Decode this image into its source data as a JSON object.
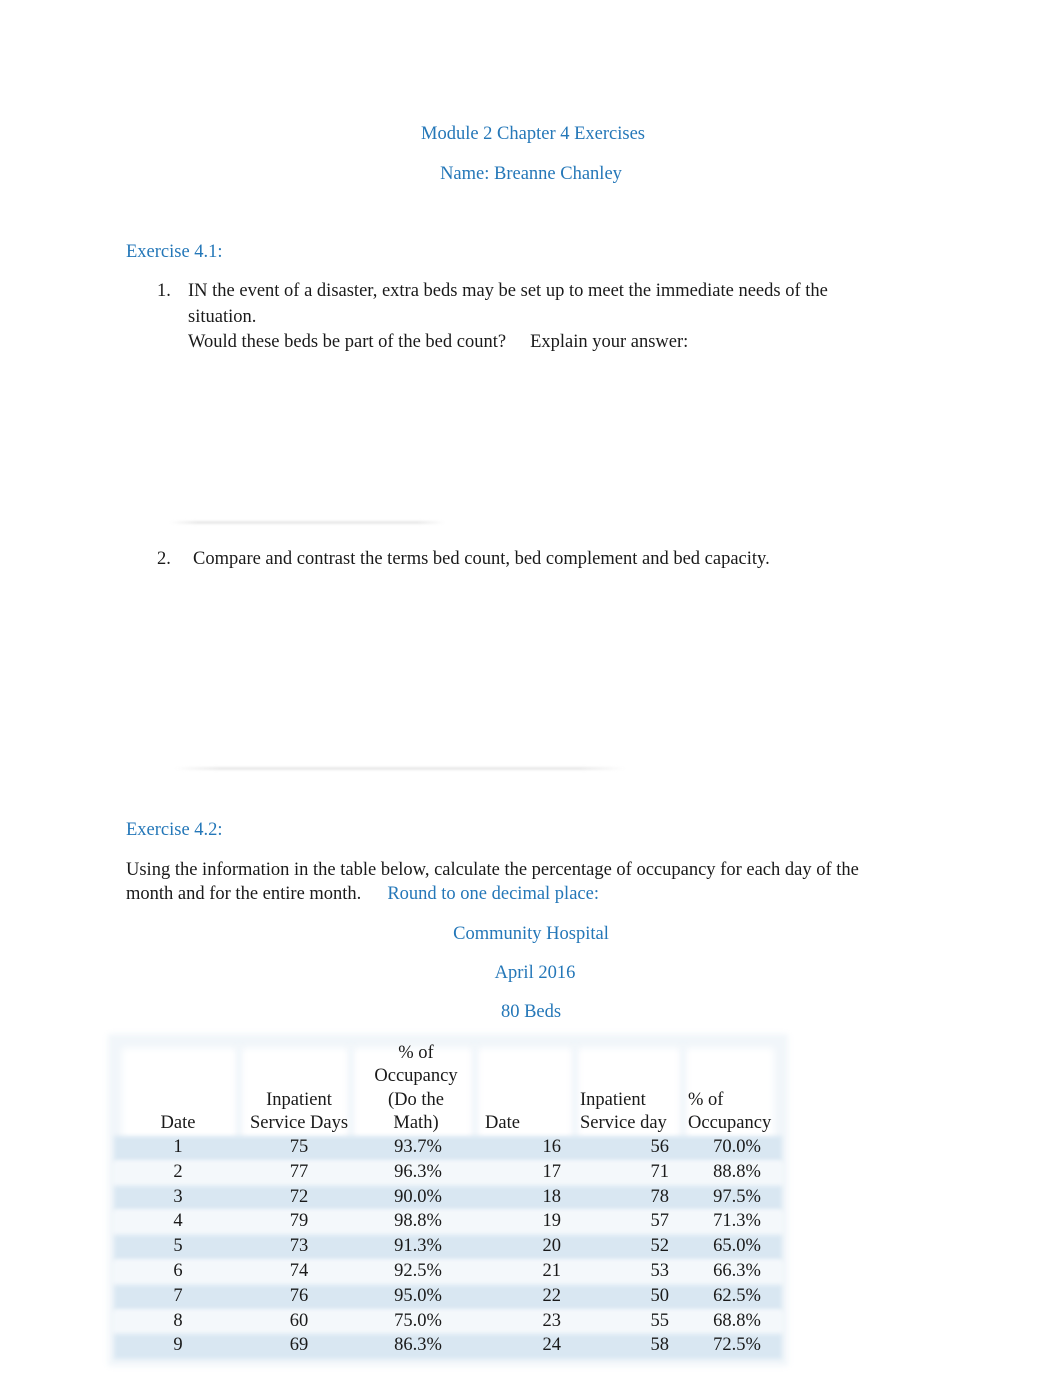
{
  "document": {
    "title": "Module 2 Chapter 4 Exercises",
    "name_line": "Name: Breanne Chanley"
  },
  "exercise_4_1": {
    "heading": "Exercise 4.1:",
    "questions": [
      {
        "number": "1.",
        "line1": "IN the event of a disaster, extra beds may be set up to meet the immediate needs of the",
        "line2": "situation.",
        "line3a": "Would these beds be part of the bed count?",
        "line3b": "Explain your answer:"
      },
      {
        "number": "2.",
        "text": "Compare and contrast the terms bed count, bed complement and bed capacity."
      }
    ]
  },
  "exercise_4_2": {
    "heading": "Exercise 4.2:",
    "instructions_line1": "Using the information in the table below, calculate the percentage of occupancy for each day of the",
    "instructions_line2": "month and for the entire month.",
    "instructions_highlight": "Round to one decimal place:",
    "table_title": "Community Hospital",
    "table_period": "April 2016",
    "table_beds": "80 Beds",
    "headers": {
      "date_left": "Date",
      "isd_left_1": "Inpatient",
      "isd_left_2": "Service Days",
      "occ_left_1": "% of",
      "occ_left_2": "Occupancy",
      "occ_left_3": "(Do the",
      "occ_left_4": "Math)",
      "date_right": "Date",
      "isd_right_1": "Inpatient",
      "isd_right_2": "Service day",
      "occ_right_1": "% of",
      "occ_right_2": "Occupancy"
    },
    "rows": [
      {
        "date_l": "1",
        "isd_l": "75",
        "occ_l": "93.7%",
        "date_r": "16",
        "isd_r": "56",
        "occ_r": "70.0%"
      },
      {
        "date_l": "2",
        "isd_l": "77",
        "occ_l": "96.3%",
        "date_r": "17",
        "isd_r": "71",
        "occ_r": "88.8%"
      },
      {
        "date_l": "3",
        "isd_l": "72",
        "occ_l": "90.0%",
        "date_r": "18",
        "isd_r": "78",
        "occ_r": "97.5%"
      },
      {
        "date_l": "4",
        "isd_l": "79",
        "occ_l": "98.8%",
        "date_r": "19",
        "isd_r": "57",
        "occ_r": "71.3%"
      },
      {
        "date_l": "5",
        "isd_l": "73",
        "occ_l": "91.3%",
        "date_r": "20",
        "isd_r": "52",
        "occ_r": "65.0%"
      },
      {
        "date_l": "6",
        "isd_l": "74",
        "occ_l": "92.5%",
        "date_r": "21",
        "isd_r": "53",
        "occ_r": "66.3%"
      },
      {
        "date_l": "7",
        "isd_l": "76",
        "occ_l": "95.0%",
        "date_r": "22",
        "isd_r": "50",
        "occ_r": "62.5%"
      },
      {
        "date_l": "8",
        "isd_l": "60",
        "occ_l": "75.0%",
        "date_r": "23",
        "isd_r": "55",
        "occ_r": "68.8%"
      },
      {
        "date_l": "9",
        "isd_l": "69",
        "occ_l": "86.3%",
        "date_r": "24",
        "isd_r": "58",
        "occ_r": "72.5%"
      }
    ]
  },
  "colors": {
    "heading_blue": "#2477b8",
    "body_text": "#1a1a1a",
    "row_band_blue": "#d9e7f2",
    "row_band_light": "#f4f8fb"
  }
}
